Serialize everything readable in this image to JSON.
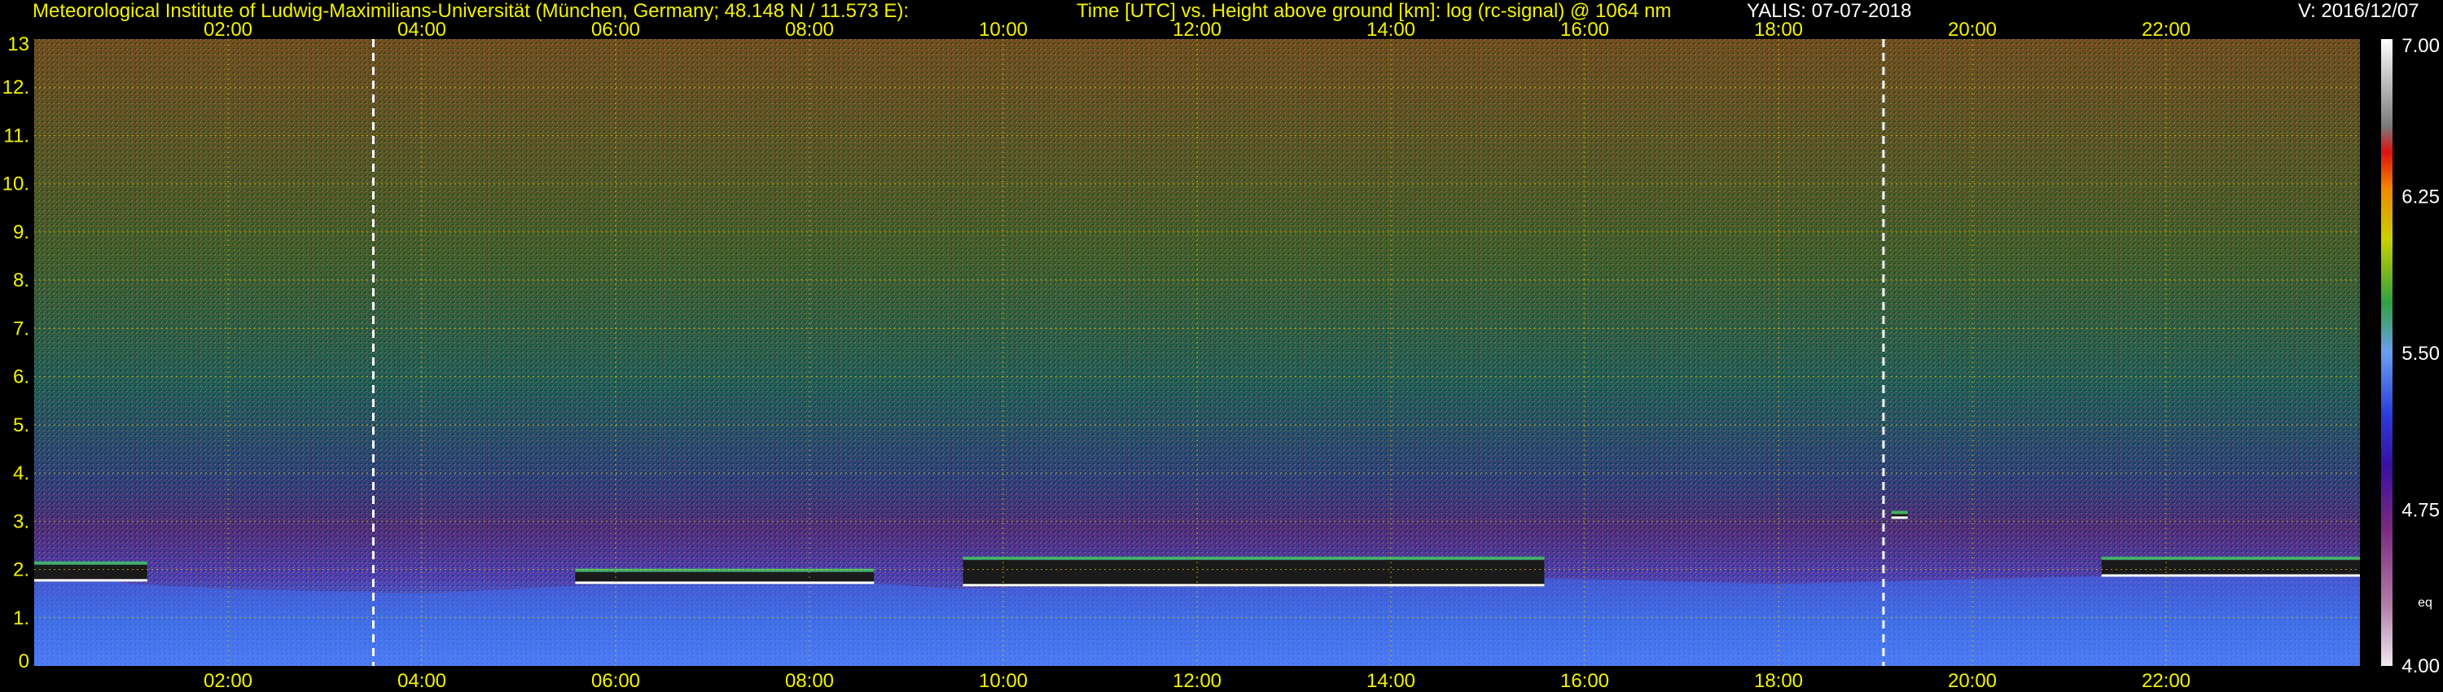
{
  "header": {
    "institute": "Meteorological Institute of Ludwig-Maximilians-Universität (München, Germany; 48.148 N / 11.573 E):",
    "description": "Time [UTC] vs. Height above ground [km]: log (rc-signal) @ 1064 nm",
    "station_date": "YALIS: 07-07-2018",
    "version": "V: 2016/12/07"
  },
  "colors": {
    "background": "#000000",
    "label_yellow": "#f2f200",
    "grid": "#e8d000",
    "marker_lines": "#ffffff"
  },
  "chart_data": {
    "type": "heatmap",
    "title": "",
    "xlabel": "",
    "ylabel": "",
    "x_range_hours_utc": [
      0,
      24
    ],
    "xlim": [
      "00:00",
      "24:00"
    ],
    "ylim": [
      0,
      13
    ],
    "x_ticks": [
      "02:00",
      "04:00",
      "06:00",
      "08:00",
      "10:00",
      "12:00",
      "14:00",
      "16:00",
      "18:00",
      "20:00",
      "22:00"
    ],
    "y_ticks": [
      "0",
      "1.",
      "2.",
      "3.",
      "4.",
      "5.",
      "6.",
      "7.",
      "8.",
      "9.",
      "10.",
      "11.",
      "12.",
      "13"
    ],
    "grid": true,
    "colorbar": {
      "ticks": [
        "7.00",
        "6.25",
        "5.50",
        "4.75",
        "4.00"
      ],
      "range": [
        4.0,
        7.0
      ],
      "unit_label": "eq"
    },
    "dashed_markers_utc": [
      "03:30",
      "19:05"
    ],
    "boundary_layer_top_km": [
      {
        "t": "00:00",
        "h": 2.1
      },
      {
        "t": "01:00",
        "h": 1.7
      },
      {
        "t": "02:00",
        "h": 1.6
      },
      {
        "t": "04:00",
        "h": 1.5
      },
      {
        "t": "06:00",
        "h": 1.7
      },
      {
        "t": "08:00",
        "h": 1.8
      },
      {
        "t": "09:30",
        "h": 1.6
      },
      {
        "t": "12:00",
        "h": 1.7
      },
      {
        "t": "14:00",
        "h": 1.9
      },
      {
        "t": "16:00",
        "h": 1.8
      },
      {
        "t": "18:00",
        "h": 1.7
      },
      {
        "t": "20:00",
        "h": 1.8
      },
      {
        "t": "22:00",
        "h": 1.9
      },
      {
        "t": "24:00",
        "h": 2.0
      }
    ],
    "cloud_layers": [
      {
        "start": "00:00",
        "end": "01:10",
        "base_km": 1.75,
        "top_km": 2.1
      },
      {
        "start": "05:35",
        "end": "08:40",
        "base_km": 1.7,
        "top_km": 1.95
      },
      {
        "start": "09:35",
        "end": "15:35",
        "base_km": 1.65,
        "top_km": 2.2
      },
      {
        "start": "19:10",
        "end": "19:20",
        "base_km": 3.05,
        "top_km": 3.15
      },
      {
        "start": "21:20",
        "end": "24:00",
        "base_km": 1.85,
        "top_km": 2.2
      }
    ]
  }
}
